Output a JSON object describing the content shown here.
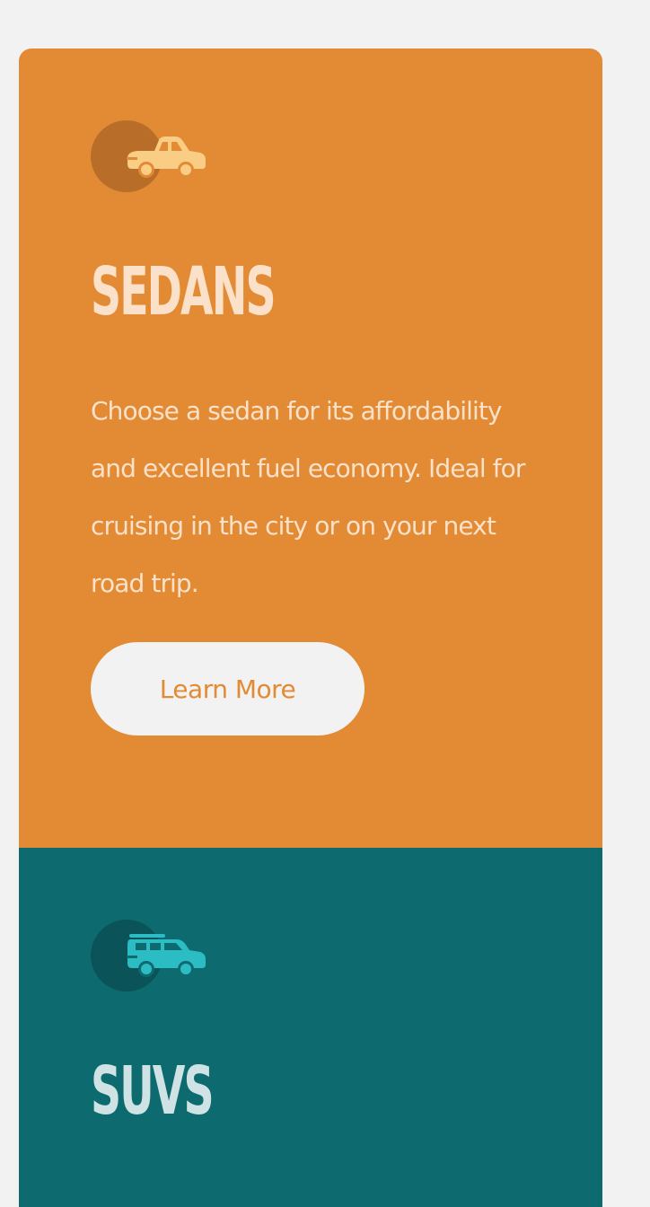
{
  "cards": [
    {
      "title": "SEDANS",
      "description": "Choose a sedan for its affordability and excellent fuel economy. Ideal for cruising in the city or on your next road trip.",
      "button_label": "Learn More",
      "icon": "sedan-icon",
      "colors": {
        "background": "#e28b34",
        "icon_circle": "#b86d29",
        "icon": "#f9cd83",
        "text": "#fbe1c9",
        "button_bg": "#f2f2f2",
        "button_text": "#e28b34"
      }
    },
    {
      "title": "SUVS",
      "icon": "suv-icon",
      "colors": {
        "background": "#0d6b70",
        "icon_circle": "#0a5358",
        "icon": "#2bbcc4",
        "text": "#cfe3e4"
      }
    }
  ],
  "page_background": "#f2f2f2"
}
